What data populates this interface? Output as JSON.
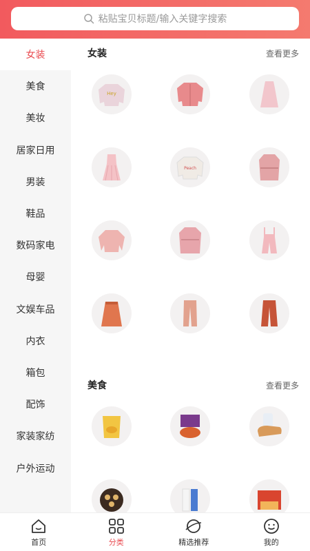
{
  "search": {
    "placeholder": "粘贴宝贝标题/输入关键字搜索"
  },
  "sidebar": {
    "items": [
      {
        "label": "女装",
        "active": true
      },
      {
        "label": "美食"
      },
      {
        "label": "美妆"
      },
      {
        "label": "居家日用"
      },
      {
        "label": "男装"
      },
      {
        "label": "鞋品"
      },
      {
        "label": "数码家电"
      },
      {
        "label": "母婴"
      },
      {
        "label": "文娱车品"
      },
      {
        "label": "内衣"
      },
      {
        "label": "箱包"
      },
      {
        "label": "配饰"
      },
      {
        "label": "家装家纺"
      },
      {
        "label": "户外运动"
      }
    ]
  },
  "sections": [
    {
      "title": "女装",
      "more": "查看更多",
      "items": [
        {
          "icon": "sweatshirt",
          "color": "#e9c7d0"
        },
        {
          "icon": "jacket",
          "color": "#e88a8c"
        },
        {
          "icon": "dress",
          "color": "#f2c6cc"
        },
        {
          "icon": "pleated-dress",
          "color": "#f4c2c6"
        },
        {
          "icon": "printed-sweatshirt",
          "color": "#f0ebe5"
        },
        {
          "icon": "trench-coat",
          "color": "#e3a4a6"
        },
        {
          "icon": "blouse",
          "color": "#eeb4b0"
        },
        {
          "icon": "coat",
          "color": "#e7a5ab"
        },
        {
          "icon": "overalls",
          "color": "#f2b9be"
        },
        {
          "icon": "skirt",
          "color": "#e0764e"
        },
        {
          "icon": "pants",
          "color": "#e2a28e"
        },
        {
          "icon": "wide-pants",
          "color": "#c65438"
        }
      ]
    },
    {
      "title": "美食",
      "more": "查看更多",
      "items": [
        {
          "icon": "snack-bag",
          "color": "#f2c542"
        },
        {
          "icon": "noodle-pack",
          "color": "#7a3a8c"
        },
        {
          "icon": "bread",
          "color": "#d89a5a"
        },
        {
          "icon": "cookie-tin",
          "color": "#3b2a20"
        },
        {
          "icon": "milk-box",
          "color": "#4a7bd1"
        },
        {
          "icon": "gift-box",
          "color": "#d9452f"
        }
      ]
    }
  ],
  "tabs": [
    {
      "label": "首页"
    },
    {
      "label": "分类",
      "active": true
    },
    {
      "label": "精选推荐"
    },
    {
      "label": "我的"
    }
  ],
  "colors": {
    "accent": "#e94a4f",
    "header_start": "#f25a5e",
    "header_end": "#f47a6f"
  }
}
